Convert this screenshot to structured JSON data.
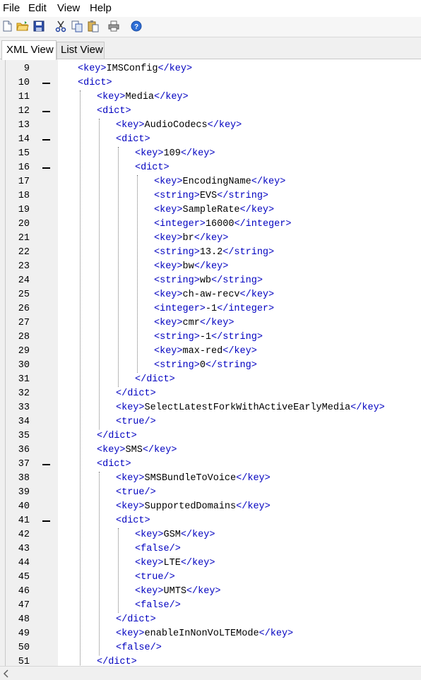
{
  "menu": [
    "File",
    "Edit",
    "View",
    "Help"
  ],
  "toolbar": [
    {
      "name": "new-file-icon"
    },
    {
      "name": "open-folder-icon"
    },
    {
      "name": "save-icon"
    },
    {
      "name": "cut-icon"
    },
    {
      "name": "copy-icon"
    },
    {
      "name": "paste-icon"
    },
    {
      "name": "print-icon"
    },
    {
      "name": "help-icon"
    }
  ],
  "tabs": {
    "active": "XML View",
    "inactive": "List View"
  },
  "colors": {
    "tag": "#0000c0",
    "text": "#000000",
    "gutter": "#f0f0f0"
  },
  "lines": [
    {
      "n": "9",
      "d": 0,
      "c": [
        [
          "<key>",
          "t"
        ],
        [
          "IMSConfig"
        ],
        [
          "</key>",
          "t"
        ]
      ]
    },
    {
      "n": "10",
      "d": 0,
      "fold": true,
      "c": [
        [
          "<dict>",
          "t"
        ]
      ]
    },
    {
      "n": "11",
      "d": 1,
      "c": [
        [
          "<key>",
          "t"
        ],
        [
          "Media"
        ],
        [
          "</key>",
          "t"
        ]
      ]
    },
    {
      "n": "12",
      "d": 1,
      "fold": true,
      "c": [
        [
          "<dict>",
          "t"
        ]
      ]
    },
    {
      "n": "13",
      "d": 2,
      "c": [
        [
          "<key>",
          "t"
        ],
        [
          "AudioCodecs"
        ],
        [
          "</key>",
          "t"
        ]
      ]
    },
    {
      "n": "14",
      "d": 2,
      "fold": true,
      "c": [
        [
          "<dict>",
          "t"
        ]
      ]
    },
    {
      "n": "15",
      "d": 3,
      "c": [
        [
          "<key>",
          "t"
        ],
        [
          "109"
        ],
        [
          "</key>",
          "t"
        ]
      ]
    },
    {
      "n": "16",
      "d": 3,
      "fold": true,
      "c": [
        [
          "<dict>",
          "t"
        ]
      ]
    },
    {
      "n": "17",
      "d": 4,
      "c": [
        [
          "<key>",
          "t"
        ],
        [
          "EncodingName"
        ],
        [
          "</key>",
          "t"
        ]
      ]
    },
    {
      "n": "18",
      "d": 4,
      "c": [
        [
          "<string>",
          "t"
        ],
        [
          "EVS"
        ],
        [
          "</string>",
          "t"
        ]
      ]
    },
    {
      "n": "19",
      "d": 4,
      "c": [
        [
          "<key>",
          "t"
        ],
        [
          "SampleRate"
        ],
        [
          "</key>",
          "t"
        ]
      ]
    },
    {
      "n": "20",
      "d": 4,
      "c": [
        [
          "<integer>",
          "t"
        ],
        [
          "16000"
        ],
        [
          "</integer>",
          "t"
        ]
      ]
    },
    {
      "n": "21",
      "d": 4,
      "c": [
        [
          "<key>",
          "t"
        ],
        [
          "br"
        ],
        [
          "</key>",
          "t"
        ]
      ]
    },
    {
      "n": "22",
      "d": 4,
      "c": [
        [
          "<string>",
          "t"
        ],
        [
          "13.2"
        ],
        [
          "</string>",
          "t"
        ]
      ]
    },
    {
      "n": "23",
      "d": 4,
      "c": [
        [
          "<key>",
          "t"
        ],
        [
          "bw"
        ],
        [
          "</key>",
          "t"
        ]
      ]
    },
    {
      "n": "24",
      "d": 4,
      "c": [
        [
          "<string>",
          "t"
        ],
        [
          "wb"
        ],
        [
          "</string>",
          "t"
        ]
      ]
    },
    {
      "n": "25",
      "d": 4,
      "c": [
        [
          "<key>",
          "t"
        ],
        [
          "ch-aw-recv"
        ],
        [
          "</key>",
          "t"
        ]
      ]
    },
    {
      "n": "26",
      "d": 4,
      "c": [
        [
          "<integer>",
          "t"
        ],
        [
          "-1"
        ],
        [
          "</integer>",
          "t"
        ]
      ]
    },
    {
      "n": "27",
      "d": 4,
      "c": [
        [
          "<key>",
          "t"
        ],
        [
          "cmr"
        ],
        [
          "</key>",
          "t"
        ]
      ]
    },
    {
      "n": "28",
      "d": 4,
      "c": [
        [
          "<string>",
          "t"
        ],
        [
          "-1"
        ],
        [
          "</string>",
          "t"
        ]
      ]
    },
    {
      "n": "29",
      "d": 4,
      "c": [
        [
          "<key>",
          "t"
        ],
        [
          "max-red"
        ],
        [
          "</key>",
          "t"
        ]
      ]
    },
    {
      "n": "30",
      "d": 4,
      "c": [
        [
          "<string>",
          "t"
        ],
        [
          "0"
        ],
        [
          "</string>",
          "t"
        ]
      ]
    },
    {
      "n": "31",
      "d": 3,
      "c": [
        [
          "</dict>",
          "t"
        ]
      ]
    },
    {
      "n": "32",
      "d": 2,
      "c": [
        [
          "</dict>",
          "t"
        ]
      ]
    },
    {
      "n": "33",
      "d": 2,
      "c": [
        [
          "<key>",
          "t"
        ],
        [
          "SelectLatestForkWithActiveEarlyMedia"
        ],
        [
          "</key>",
          "t"
        ]
      ]
    },
    {
      "n": "34",
      "d": 2,
      "c": [
        [
          "<true/>",
          "t"
        ]
      ]
    },
    {
      "n": "35",
      "d": 1,
      "c": [
        [
          "</dict>",
          "t"
        ]
      ]
    },
    {
      "n": "36",
      "d": 1,
      "c": [
        [
          "<key>",
          "t"
        ],
        [
          "SMS"
        ],
        [
          "</key>",
          "t"
        ]
      ]
    },
    {
      "n": "37",
      "d": 1,
      "fold": true,
      "c": [
        [
          "<dict>",
          "t"
        ]
      ]
    },
    {
      "n": "38",
      "d": 2,
      "c": [
        [
          "<key>",
          "t"
        ],
        [
          "SMSBundleToVoice"
        ],
        [
          "</key>",
          "t"
        ]
      ]
    },
    {
      "n": "39",
      "d": 2,
      "c": [
        [
          "<true/>",
          "t"
        ]
      ]
    },
    {
      "n": "40",
      "d": 2,
      "c": [
        [
          "<key>",
          "t"
        ],
        [
          "SupportedDomains"
        ],
        [
          "</key>",
          "t"
        ]
      ]
    },
    {
      "n": "41",
      "d": 2,
      "fold": true,
      "c": [
        [
          "<dict>",
          "t"
        ]
      ]
    },
    {
      "n": "42",
      "d": 3,
      "c": [
        [
          "<key>",
          "t"
        ],
        [
          "GSM"
        ],
        [
          "</key>",
          "t"
        ]
      ]
    },
    {
      "n": "43",
      "d": 3,
      "c": [
        [
          "<false/>",
          "t"
        ]
      ]
    },
    {
      "n": "44",
      "d": 3,
      "c": [
        [
          "<key>",
          "t"
        ],
        [
          "LTE"
        ],
        [
          "</key>",
          "t"
        ]
      ]
    },
    {
      "n": "45",
      "d": 3,
      "c": [
        [
          "<true/>",
          "t"
        ]
      ]
    },
    {
      "n": "46",
      "d": 3,
      "c": [
        [
          "<key>",
          "t"
        ],
        [
          "UMTS"
        ],
        [
          "</key>",
          "t"
        ]
      ]
    },
    {
      "n": "47",
      "d": 3,
      "c": [
        [
          "<false/>",
          "t"
        ]
      ]
    },
    {
      "n": "48",
      "d": 2,
      "c": [
        [
          "</dict>",
          "t"
        ]
      ]
    },
    {
      "n": "49",
      "d": 2,
      "c": [
        [
          "<key>",
          "t"
        ],
        [
          "enableInNonVoLTEMode"
        ],
        [
          "</key>",
          "t"
        ]
      ]
    },
    {
      "n": "50",
      "d": 2,
      "c": [
        [
          "<false/>",
          "t"
        ]
      ]
    },
    {
      "n": "51",
      "d": 1,
      "c": [
        [
          "</dict>",
          "t"
        ]
      ]
    }
  ]
}
